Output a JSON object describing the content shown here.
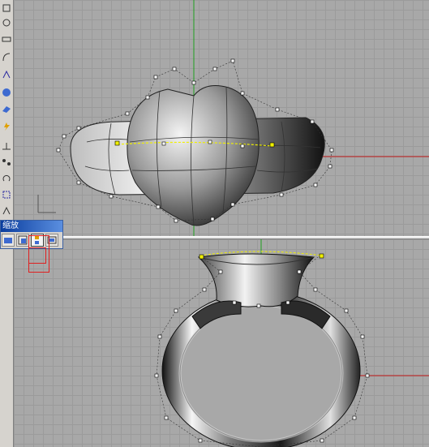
{
  "toolbar": {
    "icons": [
      "point-icon",
      "circle-icon",
      "rectangle-icon",
      "curve-icon",
      "arc-icon",
      "move-icon",
      "sphere-icon",
      "box-icon",
      "surface-icon",
      "lightning-icon",
      "dimension-icon",
      "array-icon",
      "rotate-icon",
      "scale-icon",
      "mirror-icon"
    ]
  },
  "zoom_panel": {
    "title": "缩放",
    "buttons": [
      "zoom-extents-icon",
      "zoom-window-icon",
      "zoom-selected-icon",
      "zoom-all-icon"
    ]
  },
  "viewports": {
    "top": {
      "axis_green": "#1fa01f",
      "axis_red": "#c01818",
      "name": "top-view"
    },
    "bottom": {
      "axis_green": "#1fa01f",
      "axis_red": "#c01818",
      "name": "front-view"
    }
  },
  "colors": {
    "selection_yellow": "#f0f000",
    "highlight_red": "#e02020"
  }
}
